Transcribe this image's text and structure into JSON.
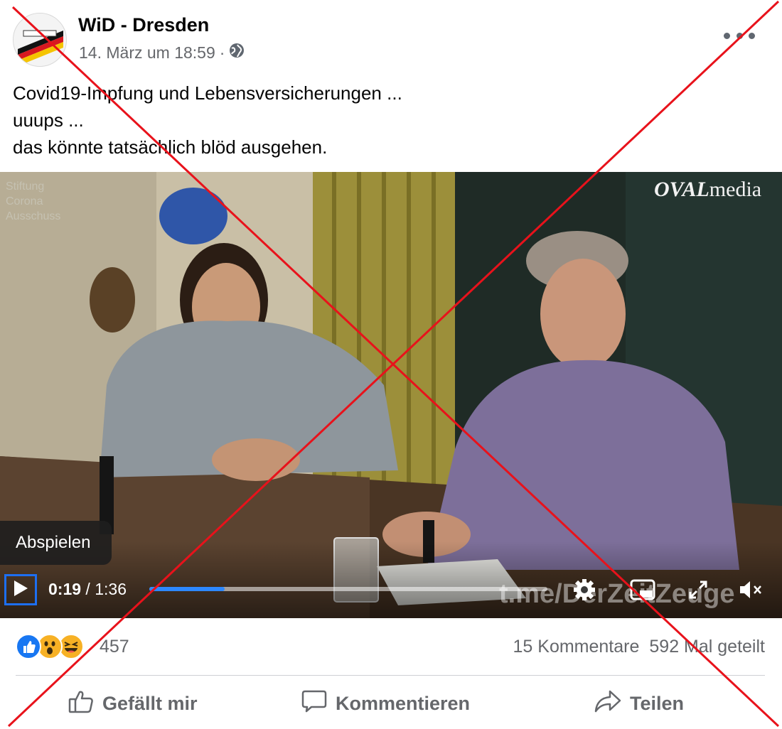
{
  "post": {
    "page_name": "WiD - Dresden",
    "timestamp": "14. März um 18:59",
    "separator": "·",
    "privacy_icon": "globe-icon",
    "more_icon": "more-options-icon",
    "text_lines": [
      "Covid19-Impfung und Lebensversicherungen ...",
      "uuups ...",
      "das könnte tatsächlich blöd ausgehen."
    ]
  },
  "video": {
    "watermark_left": [
      "Stiftung",
      "Corona",
      "Ausschuss"
    ],
    "watermark_brand_bold": "OVAL",
    "watermark_brand_rest": "media",
    "watermark_bottom": "t.me/DerZeitZeuge",
    "tooltip": "Abspielen",
    "current_time": "0:19",
    "time_separator": " / ",
    "duration": "1:36",
    "progress_fraction": 0.19,
    "controls": [
      "play-icon",
      "settings-gear-icon",
      "picture-in-picture-icon",
      "fullscreen-icon",
      "muted-speaker-icon"
    ]
  },
  "engagement": {
    "reaction_icons": [
      "like-reaction-icon",
      "wow-reaction-icon",
      "haha-reaction-icon"
    ],
    "reaction_count": "457",
    "comments": "15 Kommentare",
    "shares": "592 Mal geteilt"
  },
  "actions": {
    "like": "Gefällt mir",
    "comment": "Kommentieren",
    "share": "Teilen"
  },
  "colors": {
    "accent_blue": "#1d6ff2",
    "progress_blue": "#2d88ff",
    "secondary_text": "#65676b",
    "overlay_cross": "#e8121b"
  }
}
